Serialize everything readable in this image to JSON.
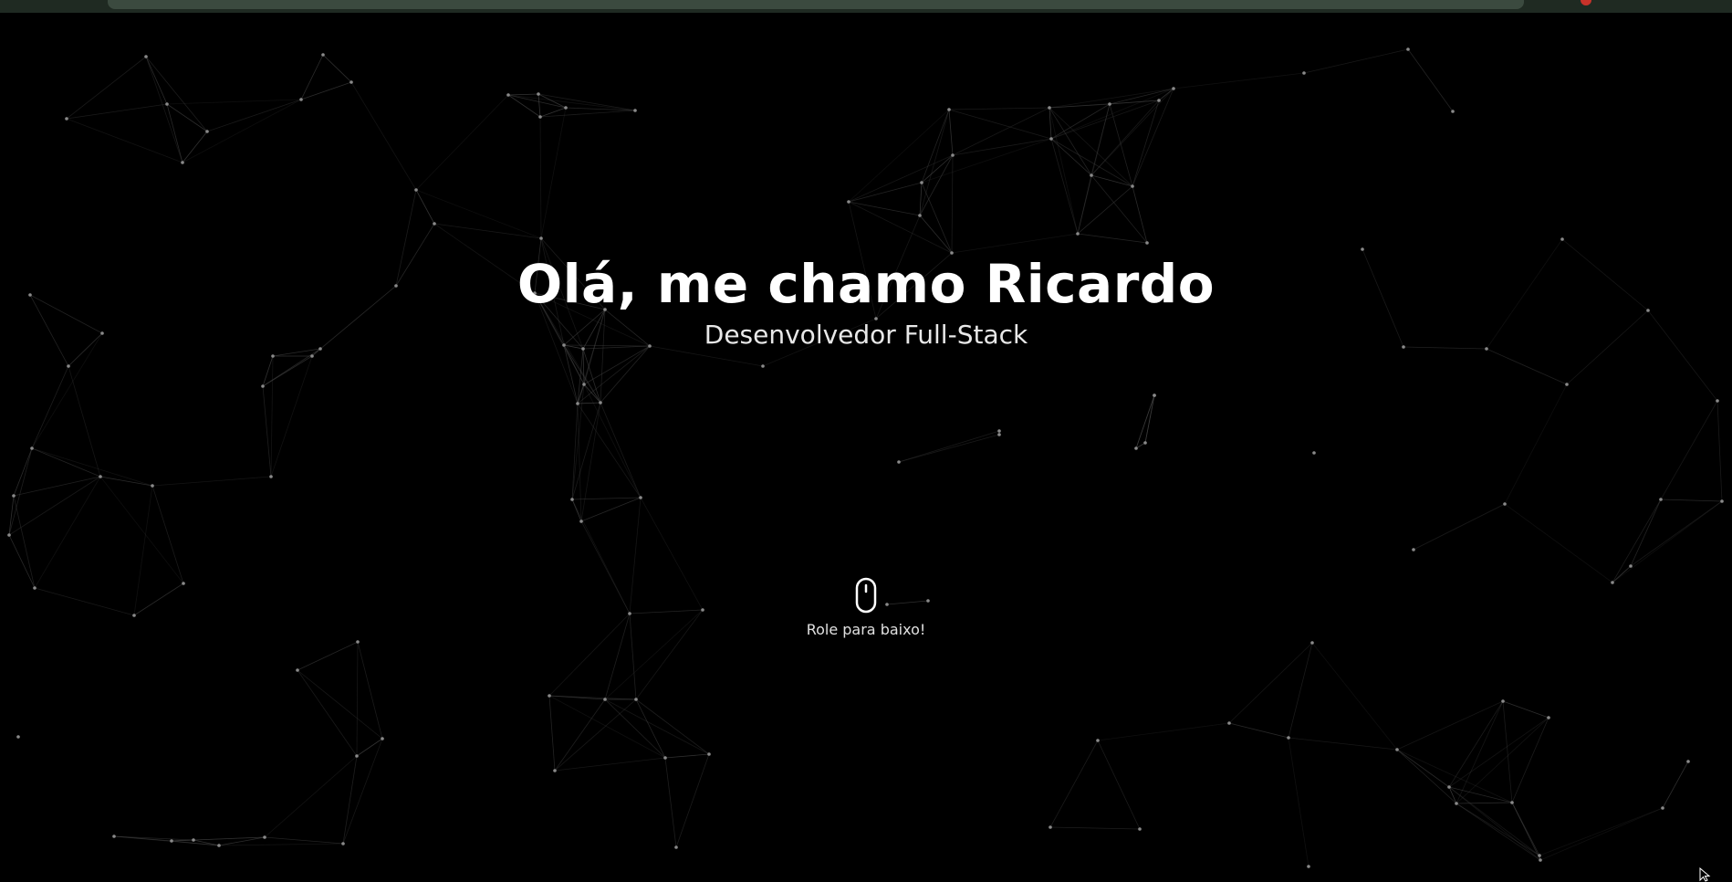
{
  "hero": {
    "title": "Olá, me chamo Ricardo",
    "subtitle": "Desenvolvedor Full-Stack"
  },
  "scroll_hint": {
    "label": "Role para baixo!",
    "icon": "mouse-icon"
  },
  "colors": {
    "background": "#000000",
    "text": "#ffffff",
    "particle": "#8a8a8a",
    "link": "#444444",
    "top_strip": "#3b4a3f",
    "indicator": "#c8322a"
  }
}
